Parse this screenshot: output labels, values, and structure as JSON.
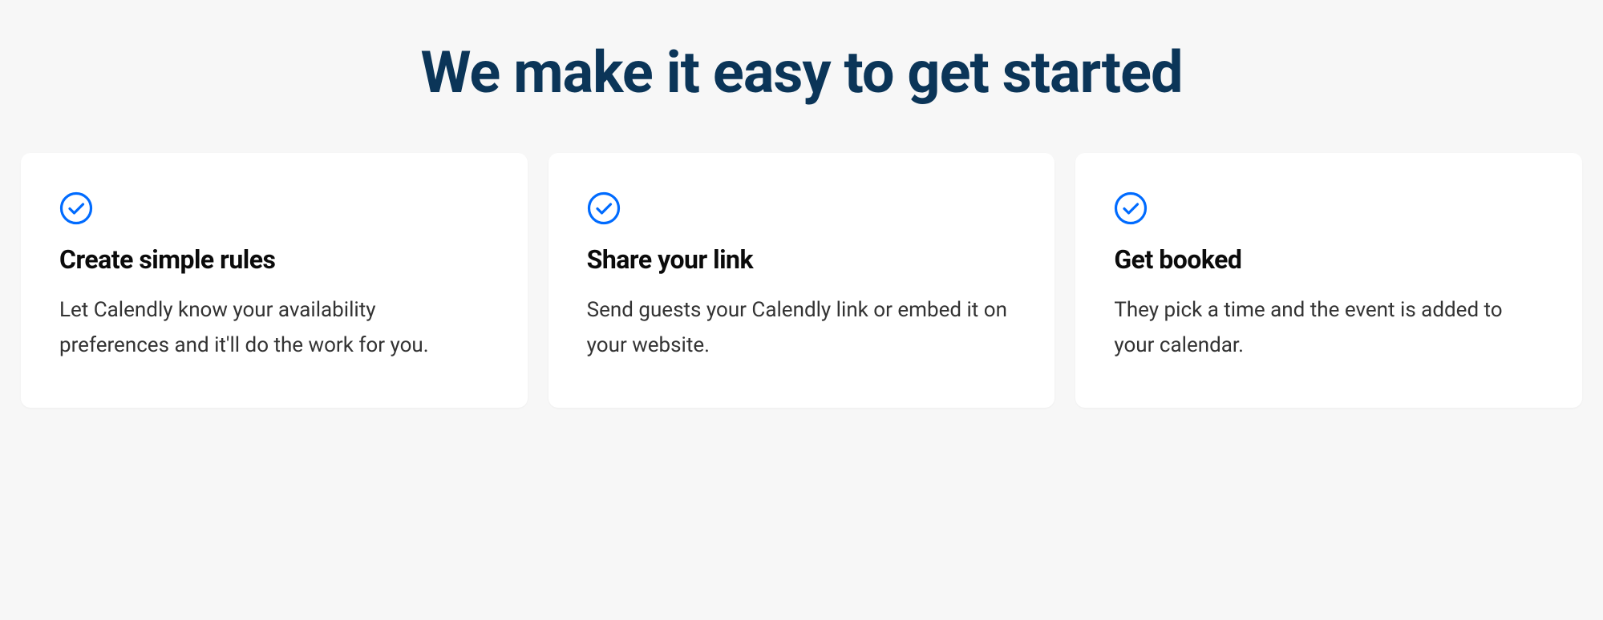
{
  "heading": "We make it easy to get started",
  "cards": [
    {
      "title": "Create simple rules",
      "description": "Let Calendly know your availability preferences and it'll do the work for you."
    },
    {
      "title": "Share your link",
      "description": "Send guests your Calendly link or embed it on your website."
    },
    {
      "title": "Get booked",
      "description": "They pick a time and the event is added to your calendar."
    }
  ],
  "colors": {
    "heading": "#0b3558",
    "icon": "#006bff",
    "background": "#f7f7f7",
    "card_bg": "#ffffff"
  }
}
